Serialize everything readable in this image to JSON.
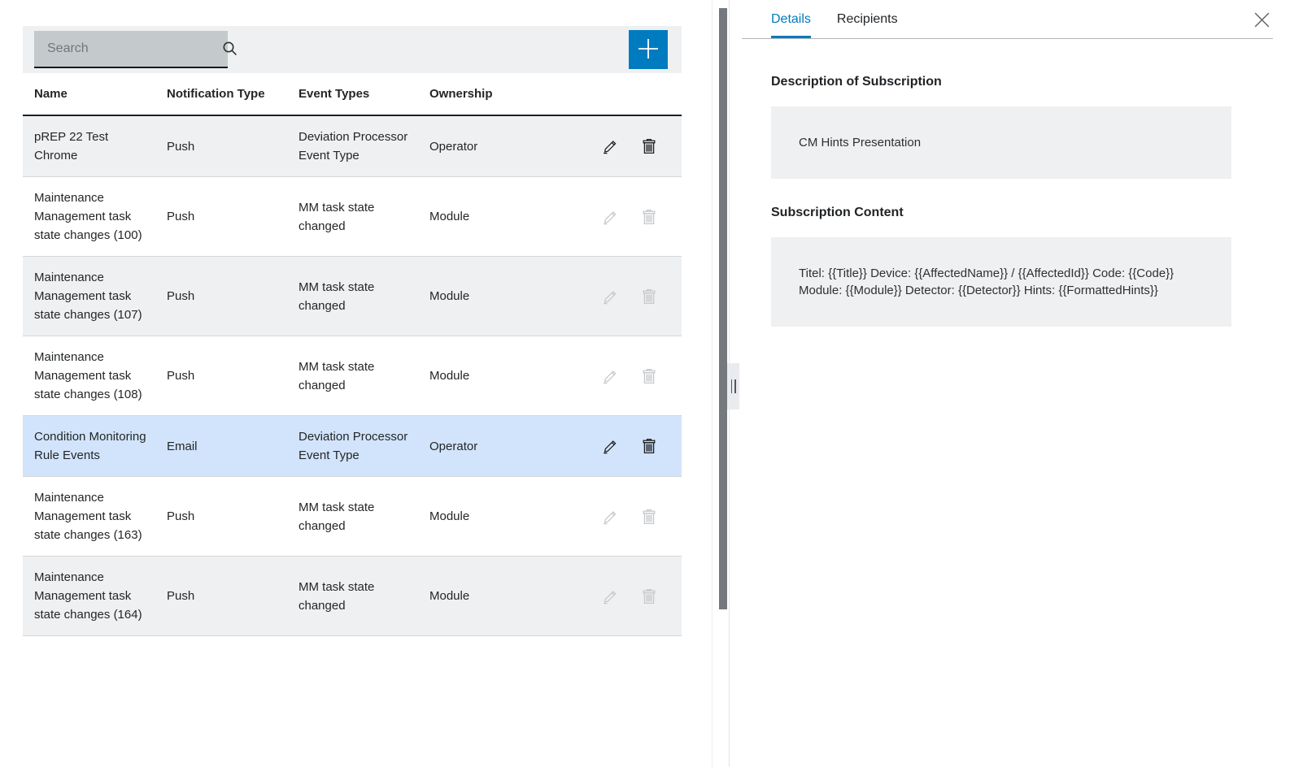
{
  "colors": {
    "accent_blue": "#007bc0",
    "selected_row_blue": "#d2e4fb",
    "shaded_row_gray": "#eff0f1",
    "search_field_gray": "#c4cacc",
    "content_box_gray": "#eff0f1"
  },
  "left_panel": {
    "toolbar": {
      "search_placeholder": "Search",
      "search_icon": "magnifier-icon",
      "add_icon": "plus-icon"
    },
    "table": {
      "columns": [
        "Name",
        "Notification Type",
        "Event Types",
        "Ownership"
      ],
      "action_icons": [
        "edit-pencil-icon",
        "delete-trash-icon"
      ],
      "rows": [
        {
          "name": "pREP 22 Test Chrome",
          "notification_type": "Push",
          "event_types": "Deviation Processor Event Type",
          "ownership": "Operator",
          "actions_enabled": true,
          "selected": false
        },
        {
          "name": "Maintenance Management task state changes (100)",
          "notification_type": "Push",
          "event_types": "MM task state changed",
          "ownership": "Module",
          "actions_enabled": false,
          "selected": false
        },
        {
          "name": "Maintenance Management task state changes (107)",
          "notification_type": "Push",
          "event_types": "MM task state changed",
          "ownership": "Module",
          "actions_enabled": false,
          "selected": false
        },
        {
          "name": "Maintenance Management task state changes (108)",
          "notification_type": "Push",
          "event_types": "MM task state changed",
          "ownership": "Module",
          "actions_enabled": false,
          "selected": false
        },
        {
          "name": "Condition Monitoring Rule Events",
          "notification_type": "Email",
          "event_types": "Deviation Processor Event Type",
          "ownership": "Operator",
          "actions_enabled": true,
          "selected": true
        },
        {
          "name": "Maintenance Management task state changes (163)",
          "notification_type": "Push",
          "event_types": "MM task state changed",
          "ownership": "Module",
          "actions_enabled": false,
          "selected": false
        },
        {
          "name": "Maintenance Management task state changes (164)",
          "notification_type": "Push",
          "event_types": "MM task state changed",
          "ownership": "Module",
          "actions_enabled": false,
          "selected": false
        }
      ]
    }
  },
  "right_panel": {
    "tabs": [
      {
        "label": "Details",
        "active": true
      },
      {
        "label": "Recipients",
        "active": false
      }
    ],
    "close_icon": "close-x-icon",
    "sections": [
      {
        "heading": "Description of Subscription",
        "content": "CM Hints Presentation"
      },
      {
        "heading": "Subscription Content",
        "content": "Titel: {{Title}} Device: {{AffectedName}} / {{AffectedId}} Code: {{Code}} Module: {{Module}} Detector: {{Detector}} Hints: {{FormattedHints}}"
      }
    ]
  }
}
